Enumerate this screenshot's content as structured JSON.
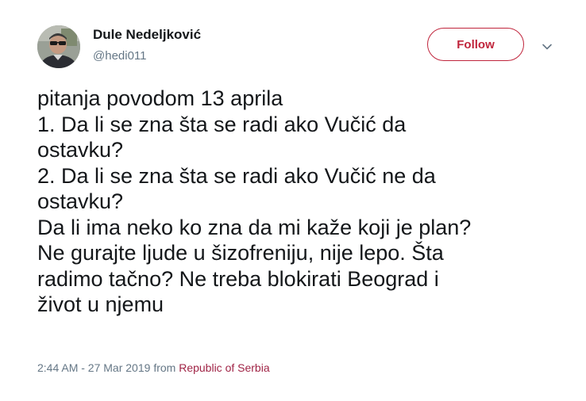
{
  "author": {
    "name": "Dule Nedeljković",
    "handle": "@hedi011",
    "avatar_icon": "user-avatar-photo"
  },
  "actions": {
    "follow_label": "Follow",
    "menu_icon": "chevron-down-icon"
  },
  "tweet": {
    "lines": [
      "pitanja povodom 13 aprila",
      "1. Da li se zna šta se radi ako Vučić da",
      "ostavku?",
      "2. Da li se zna šta se radi ako Vučić ne da",
      "ostavku?",
      "Da li ima neko ko zna da mi kaže koji je plan?",
      "Ne gurajte ljude u šizofreniju, nije lepo. Šta",
      "radimo tačno? Ne treba blokirati Beograd i",
      "život u njemu"
    ]
  },
  "meta": {
    "timestamp": "2:44 AM - 27 Mar 2019",
    "from_label": "from",
    "place": "Republic of Serbia"
  },
  "colors": {
    "accent": "#c0253c",
    "place_link": "#a02446",
    "secondary_text": "#657786",
    "primary_text": "#14171a"
  }
}
